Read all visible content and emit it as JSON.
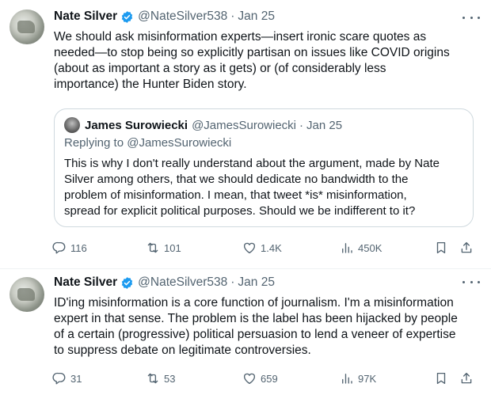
{
  "tweets": [
    {
      "author": "Nate Silver",
      "handle": "@NateSilver538",
      "separator": "·",
      "date": "Jan 25",
      "lines": [
        "We should ask misinformation experts—insert ironic scare quotes as",
        "needed—to stop being so explicitly partisan on issues like COVID origins",
        "(about as important a story as it gets) or (of considerably less",
        "importance) the Hunter Biden story."
      ],
      "quote": {
        "author": "James Surowiecki",
        "handle": "@JamesSurowiecki",
        "separator": "·",
        "date": "Jan 25",
        "replying_prefix": "Replying to",
        "replying_handle": "@JamesSurowiecki",
        "lines": [
          "This is why I don't really understand about the argument, made by Nate",
          "Silver among others, that we should dedicate no bandwidth to the",
          "problem of misinformation. I mean, that tweet *is* misinformation,",
          "spread for explicit political purposes. Should we be indifferent to it?"
        ]
      },
      "stats": {
        "replies": "116",
        "reposts": "101",
        "likes": "1.4K",
        "views": "450K"
      }
    },
    {
      "author": "Nate Silver",
      "handle": "@NateSilver538",
      "separator": "·",
      "date": "Jan 25",
      "lines": [
        "ID'ing misinformation is a core function of journalism. I'm a misinformation",
        "expert in that sense. The problem is the label has been hijacked by people",
        "of a certain (progressive) political persuasion to lend a veneer of expertise",
        "to suppress debate on legitimate controversies."
      ],
      "stats": {
        "replies": "31",
        "reposts": "53",
        "likes": "659",
        "views": "97K"
      }
    }
  ],
  "icons": [
    "verified-badge-icon",
    "more-icon",
    "reply-icon",
    "repost-icon",
    "like-icon",
    "views-icon",
    "bookmark-icon",
    "share-icon"
  ],
  "colors": {
    "text": "#0f1419",
    "secondary": "#536471",
    "verified": "#1d9bf0",
    "border": "#cfd9de"
  }
}
